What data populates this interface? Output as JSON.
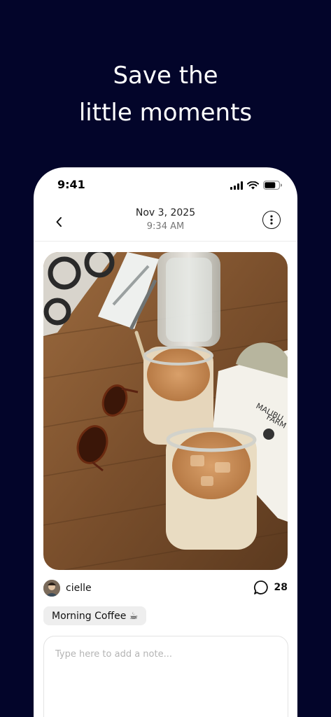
{
  "headline": {
    "line1": "Save the",
    "line2": "little moments"
  },
  "status_bar": {
    "time": "9:41"
  },
  "header": {
    "date": "Nov 3, 2025",
    "time": "9:34 AM"
  },
  "post": {
    "author": "cielle",
    "comment_count": "28",
    "tag": "Morning Coffee ☕",
    "photo_sign_text": [
      "MALIBU",
      "FARM"
    ]
  },
  "note": {
    "placeholder": "Type here to add a note...",
    "value": ""
  },
  "icons": {
    "back": "chevron-left-icon",
    "more": "more-vertical-circle-icon",
    "comment": "comment-bubble-icon",
    "signal": "cellular-signal-icon",
    "wifi": "wifi-icon",
    "battery": "battery-icon"
  },
  "colors": {
    "background": "#03052a",
    "card": "#ffffff",
    "tag_bg": "#eeeeee"
  }
}
